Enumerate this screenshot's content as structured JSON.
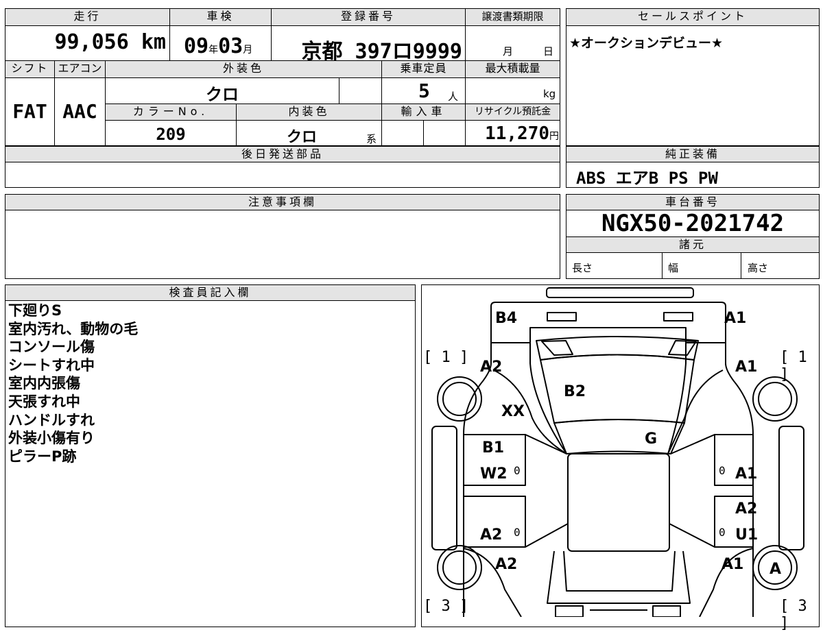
{
  "vehicle": {
    "mileage_label": "走行",
    "mileage_value": "99,056",
    "mileage_unit": "km",
    "inspection_label": "車検",
    "inspection_year": "09",
    "inspection_year_unit": "年",
    "inspection_month": "03",
    "inspection_month_unit": "月",
    "registration_label": "登録番号",
    "registration_value": "京都 397ロ9999",
    "transfer_label": "譲渡書類期限",
    "transfer_month_unit": "月",
    "transfer_day_unit": "日",
    "shift_label": "シフト",
    "shift_value": "FAT",
    "aircon_label": "エアコン",
    "aircon_value": "AAC",
    "exterior_label": "外装色",
    "exterior_value": "クロ",
    "capacity_label": "乗車定員",
    "capacity_value": "5",
    "capacity_unit": "人",
    "maxload_label": "最大積載量",
    "maxload_unit": "kg",
    "color_no_label": "カラーNo.",
    "color_no_value": "209",
    "interior_label": "内装色",
    "interior_value": "クロ",
    "interior_unit": "系",
    "import_label": "輸入車",
    "recycle_label": "リサイクル預託金",
    "recycle_value": "11,270",
    "recycle_unit": "円",
    "later_parts_label": "後日発送部品",
    "caution_label": "注意事項欄",
    "inspector_label": "検査員記入欄"
  },
  "sales": {
    "label": "セールスポイント",
    "text": "★オークションデビュー★"
  },
  "equipment": {
    "label": "純正装備",
    "value": "ABS エアB PS PW"
  },
  "chassis": {
    "label": "車台番号",
    "value": "NGX50-2021742",
    "spec_label": "諸元",
    "length_label": "長さ",
    "width_label": "幅",
    "height_label": "高さ"
  },
  "inspector_notes": [
    "下廻りS",
    "室内汚れ、動物の毛",
    "コンソール傷",
    "シートすれ中",
    "室内内張傷",
    "天張すれ中",
    "ハンドルすれ",
    "外装小傷有り",
    "ピラーP跡"
  ],
  "diagram": {
    "labels": {
      "b4": "B4",
      "a1_top": "A1",
      "a2_front_left": "A2",
      "a1_front_right": "A1",
      "b2": "B2",
      "xx": "XX",
      "g": "G",
      "b1": "B1",
      "w2": "W2",
      "a1_door_right": "A1",
      "a2_right": "A2",
      "a2_rear_left": "A2",
      "u1": "U1",
      "a2_rear_wheel": "A2",
      "a1_rear_right": "A1",
      "a_wheel": "A"
    },
    "brackets": {
      "fl": "[ 1 ]",
      "fr": "[ 1 ]",
      "rl": "[ 3 ]",
      "rr": "[ 3 ]"
    },
    "zeros": {
      "z1": "0",
      "z2": "0",
      "z3": "0",
      "z4": "0"
    }
  }
}
